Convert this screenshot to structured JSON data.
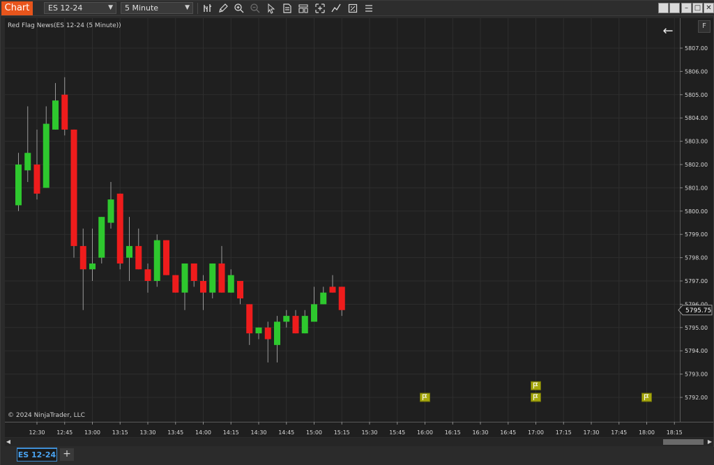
{
  "toolbar": {
    "chart_label": "Chart",
    "instrument": "ES 12-24",
    "interval": "5 Minute",
    "icons": [
      "bars-type-icon",
      "draw-pencil-icon",
      "zoom-in-icon",
      "zoom-out-icon",
      "select-pointer-icon",
      "properties-icon",
      "template-icon",
      "chart-trader-icon",
      "strategy-icon",
      "data-box-icon",
      "more-tools-icon"
    ],
    "window_buttons": [
      "tile-icon",
      "tile2-icon",
      "minimize-icon",
      "maximize-icon",
      "close-icon"
    ]
  },
  "indicator_label": "Red Flag News(ES 12-24 (5 Minute))",
  "copyright": "© 2024 NinjaTrader, LLC",
  "f_button": "F",
  "bottom_tab": {
    "label": "ES 12-24",
    "add_label": "+"
  },
  "colors": {
    "up": "#2ec82e",
    "down": "#ee1c1c",
    "wick": "#9a9a9a",
    "flag": "#a6a70c",
    "grid": "#2e2e2e",
    "background": "#1f1f1f"
  },
  "chart_data": {
    "type": "candlestick",
    "instrument": "ES 12-24",
    "bar_period": "5 Minute",
    "current_price": "5795.75",
    "ylim": [
      5791.0,
      5808.0
    ],
    "y_ticks": [
      "5792.00",
      "5793.00",
      "5794.00",
      "5795.00",
      "5796.00",
      "5797.00",
      "5798.00",
      "5799.00",
      "5800.00",
      "5801.00",
      "5802.00",
      "5803.00",
      "5804.00",
      "5805.00",
      "5806.00",
      "5807.00"
    ],
    "x_ticks": [
      "12:30",
      "12:45",
      "13:00",
      "13:15",
      "13:30",
      "13:45",
      "14:00",
      "14:15",
      "14:30",
      "14:45",
      "15:00",
      "15:15",
      "15:30",
      "15:45",
      "16:00",
      "16:15",
      "16:30",
      "16:45",
      "17:00",
      "17:15",
      "17:30",
      "17:45",
      "18:00",
      "18:15"
    ],
    "candles": [
      {
        "t": "12:20",
        "o": 5800.25,
        "h": 5802.5,
        "l": 5800.0,
        "c": 5802.0
      },
      {
        "t": "12:25",
        "o": 5801.75,
        "h": 5804.5,
        "l": 5801.25,
        "c": 5802.5
      },
      {
        "t": "12:30",
        "o": 5802.0,
        "h": 5803.5,
        "l": 5800.5,
        "c": 5800.75
      },
      {
        "t": "12:35",
        "o": 5801.0,
        "h": 5804.5,
        "l": 5801.0,
        "c": 5803.75
      },
      {
        "t": "12:40",
        "o": 5803.5,
        "h": 5805.5,
        "l": 5803.5,
        "c": 5804.75
      },
      {
        "t": "12:45",
        "o": 5805.0,
        "h": 5805.75,
        "l": 5803.25,
        "c": 5803.5
      },
      {
        "t": "12:50",
        "o": 5803.5,
        "h": 5803.5,
        "l": 5798.0,
        "c": 5798.5
      },
      {
        "t": "12:55",
        "o": 5798.5,
        "h": 5799.25,
        "l": 5795.75,
        "c": 5797.5
      },
      {
        "t": "13:00",
        "o": 5797.5,
        "h": 5799.25,
        "l": 5797.0,
        "c": 5797.75
      },
      {
        "t": "13:05",
        "o": 5798.0,
        "h": 5799.75,
        "l": 5797.75,
        "c": 5799.75
      },
      {
        "t": "13:10",
        "o": 5799.5,
        "h": 5801.25,
        "l": 5799.25,
        "c": 5800.5
      },
      {
        "t": "13:15",
        "o": 5800.75,
        "h": 5800.75,
        "l": 5797.5,
        "c": 5797.75
      },
      {
        "t": "13:20",
        "o": 5798.0,
        "h": 5799.75,
        "l": 5797.0,
        "c": 5798.5
      },
      {
        "t": "13:25",
        "o": 5798.5,
        "h": 5799.25,
        "l": 5797.5,
        "c": 5797.5
      },
      {
        "t": "13:30",
        "o": 5797.5,
        "h": 5797.75,
        "l": 5796.5,
        "c": 5797.0
      },
      {
        "t": "13:35",
        "o": 5797.0,
        "h": 5799.0,
        "l": 5796.75,
        "c": 5798.75
      },
      {
        "t": "13:40",
        "o": 5798.75,
        "h": 5798.75,
        "l": 5797.25,
        "c": 5797.25
      },
      {
        "t": "13:45",
        "o": 5797.25,
        "h": 5797.25,
        "l": 5796.5,
        "c": 5796.5
      },
      {
        "t": "13:50",
        "o": 5796.5,
        "h": 5797.75,
        "l": 5795.75,
        "c": 5797.75
      },
      {
        "t": "13:55",
        "o": 5797.75,
        "h": 5797.75,
        "l": 5796.75,
        "c": 5797.0
      },
      {
        "t": "14:00",
        "o": 5797.0,
        "h": 5797.25,
        "l": 5795.75,
        "c": 5796.5
      },
      {
        "t": "14:05",
        "o": 5796.5,
        "h": 5797.75,
        "l": 5796.25,
        "c": 5797.75
      },
      {
        "t": "14:10",
        "o": 5797.75,
        "h": 5798.5,
        "l": 5796.5,
        "c": 5796.5
      },
      {
        "t": "14:15",
        "o": 5796.5,
        "h": 5797.5,
        "l": 5796.5,
        "c": 5797.25
      },
      {
        "t": "14:20",
        "o": 5797.0,
        "h": 5797.0,
        "l": 5796.0,
        "c": 5796.25
      },
      {
        "t": "14:25",
        "o": 5796.0,
        "h": 5796.0,
        "l": 5794.25,
        "c": 5794.75
      },
      {
        "t": "14:30",
        "o": 5794.75,
        "h": 5795.0,
        "l": 5794.5,
        "c": 5795.0
      },
      {
        "t": "14:35",
        "o": 5795.0,
        "h": 5795.25,
        "l": 5793.5,
        "c": 5794.5
      },
      {
        "t": "14:40",
        "o": 5794.25,
        "h": 5795.5,
        "l": 5793.5,
        "c": 5795.25
      },
      {
        "t": "14:45",
        "o": 5795.25,
        "h": 5795.75,
        "l": 5795.0,
        "c": 5795.5
      },
      {
        "t": "14:50",
        "o": 5795.5,
        "h": 5795.75,
        "l": 5794.75,
        "c": 5794.75
      },
      {
        "t": "14:55",
        "o": 5794.75,
        "h": 5795.75,
        "l": 5794.75,
        "c": 5795.5
      },
      {
        "t": "15:00",
        "o": 5795.25,
        "h": 5796.75,
        "l": 5795.25,
        "c": 5796.0
      },
      {
        "t": "15:05",
        "o": 5796.0,
        "h": 5796.75,
        "l": 5796.0,
        "c": 5796.5
      },
      {
        "t": "15:10",
        "o": 5796.75,
        "h": 5797.25,
        "l": 5796.5,
        "c": 5796.5
      },
      {
        "t": "15:15",
        "o": 5796.75,
        "h": 5796.75,
        "l": 5795.5,
        "c": 5795.75
      }
    ],
    "news_flags": [
      {
        "t": "16:00",
        "price": 5792.0
      },
      {
        "t": "17:00",
        "price": 5792.5
      },
      {
        "t": "17:00",
        "price": 5792.0
      },
      {
        "t": "18:00",
        "price": 5792.0
      }
    ]
  }
}
